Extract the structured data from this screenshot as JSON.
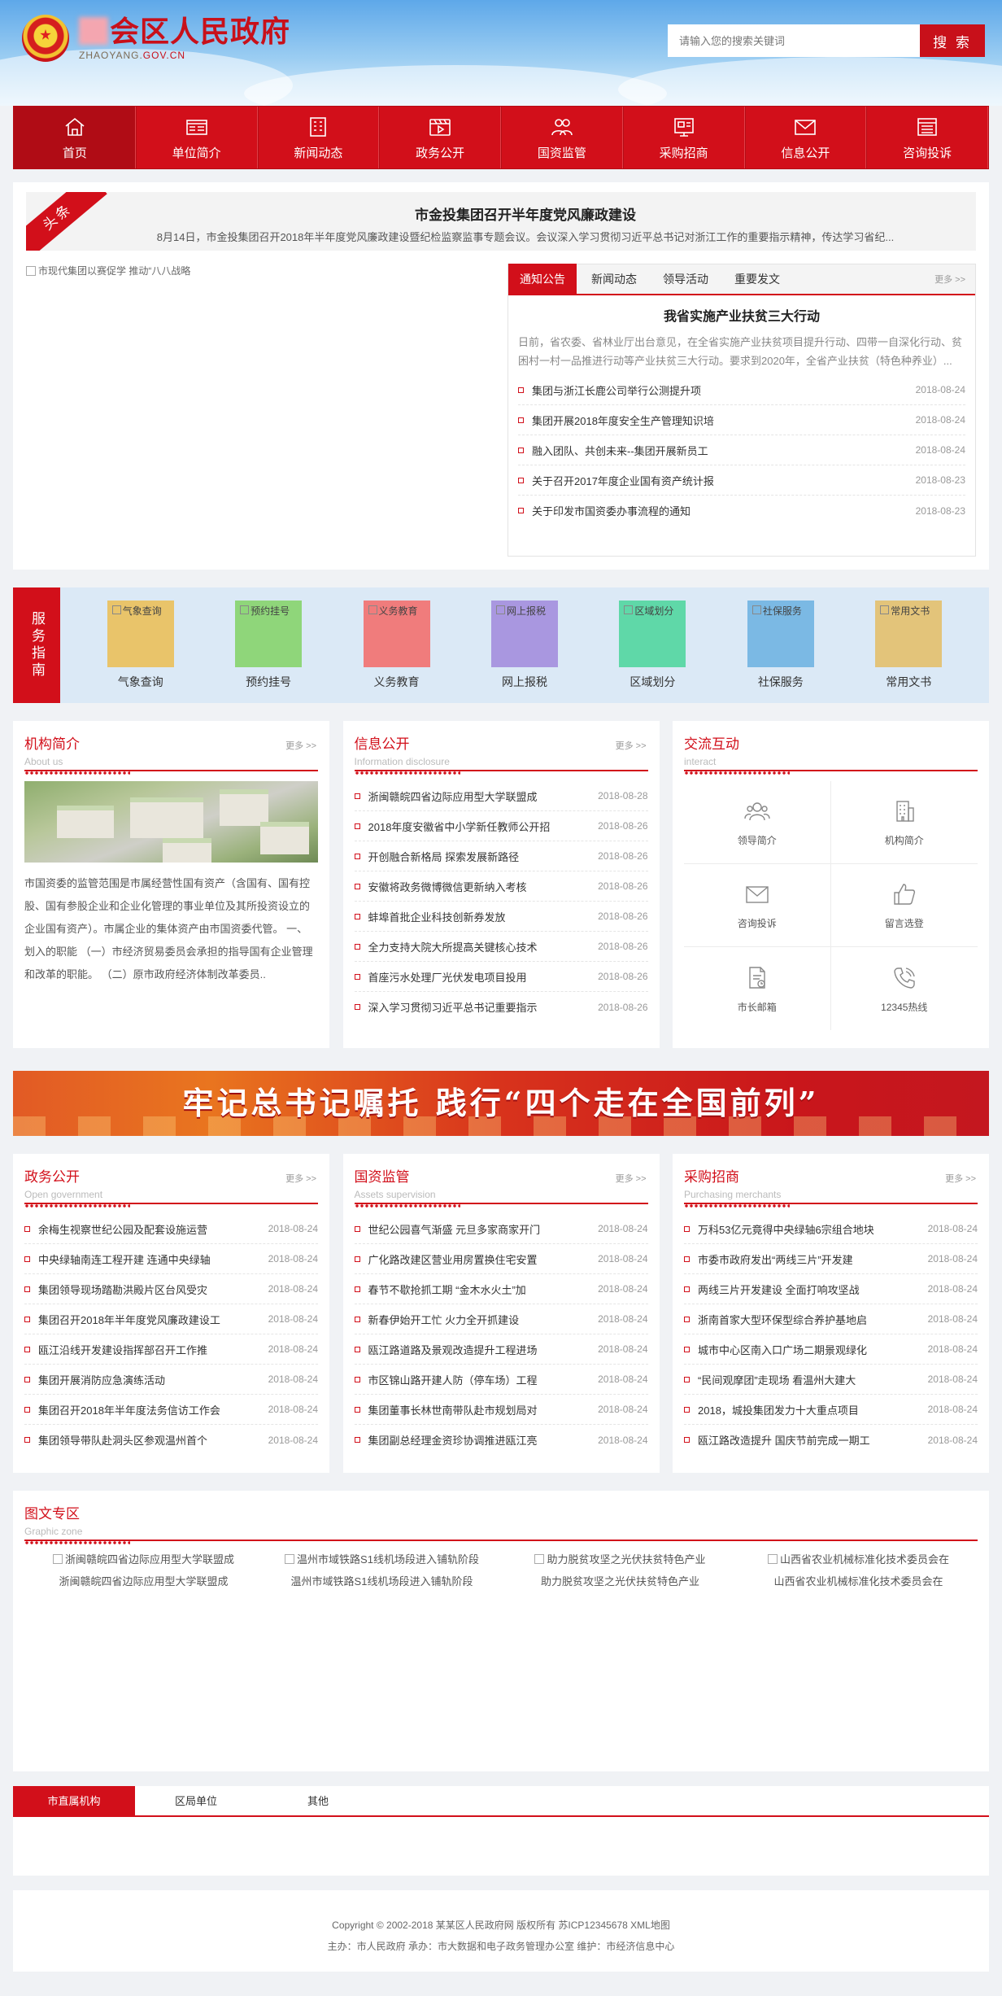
{
  "header": {
    "site_name": "会区人民政府",
    "domain_prefix": "ZHAOYANG.",
    "domain_suffix": "GOV.CN",
    "search_placeholder": "请输入您的搜索关键词",
    "search_button": "搜 索"
  },
  "nav": [
    {
      "label": "首页",
      "icon": "home-icon"
    },
    {
      "label": "单位简介",
      "icon": "news-icon"
    },
    {
      "label": "新闻动态",
      "icon": "building-icon"
    },
    {
      "label": "政务公开",
      "icon": "video-icon"
    },
    {
      "label": "国资监管",
      "icon": "users-icon"
    },
    {
      "label": "采购招商",
      "icon": "board-icon"
    },
    {
      "label": "信息公开",
      "icon": "mail-icon"
    },
    {
      "label": "咨询投诉",
      "icon": "document-icon"
    }
  ],
  "headline": {
    "ribbon": "头条",
    "title": "市金投集团召开半年度党风廉政建设",
    "summary": "8月14日，市金投集团召开2018年半年度党风廉政建设暨纪检监察监事专题会议。会议深入学习贯彻习近平总书记对浙江工作的重要指示精神，传达学习省纪..."
  },
  "slide_alt": "市现代集团以赛促学 推动“八八战略",
  "news_tabs": [
    "通知公告",
    "新闻动态",
    "领导活动",
    "重要发文"
  ],
  "more": "更多 >>",
  "featured": {
    "title": "我省实施产业扶贫三大行动",
    "text": "日前，省农委、省林业厅出台意见，在全省实施产业扶贫项目提升行动、四带一自深化行动、贫困村一村一品推进行动等产业扶贫三大行动。要求到2020年，全省产业扶贫（特色种养业）..."
  },
  "notice_list": [
    {
      "text": "集团与浙江长鹿公司举行公测提升项",
      "date": "2018-08-24"
    },
    {
      "text": "集团开展2018年度安全生产管理知识培",
      "date": "2018-08-24"
    },
    {
      "text": "融入团队、共创未来--集团开展新员工",
      "date": "2018-08-24"
    },
    {
      "text": "关于召开2017年度企业国有资产统计报",
      "date": "2018-08-23"
    },
    {
      "text": "关于印发市国资委办事流程的通知",
      "date": "2018-08-23"
    }
  ],
  "service": {
    "label": "服务指南",
    "items": [
      {
        "label": "气象查询",
        "color": "#e9c46a"
      },
      {
        "label": "预约挂号",
        "color": "#8fd67a"
      },
      {
        "label": "义务教育",
        "color": "#f07c7c"
      },
      {
        "label": "网上报税",
        "color": "#a997e0"
      },
      {
        "label": "区域划分",
        "color": "#5fd8a8"
      },
      {
        "label": "社保服务",
        "color": "#7bb9e4"
      },
      {
        "label": "常用文书",
        "color": "#e3c47a"
      }
    ]
  },
  "about": {
    "cn": "机构简介",
    "en": "About us",
    "text": "市国资委的监管范围是市属经营性国有资产（含国有、国有控股、国有参股企业和企业化管理的事业单位及其所投资设立的企业国有资产）。市属企业的集体资产由市国资委代管。 一、划入的职能 （一）市经济贸易委员会承担的指导国有企业管理和改革的职能。 （二）原市政府经济体制改革委员.."
  },
  "info": {
    "cn": "信息公开",
    "en": "Information disclosure",
    "items": [
      {
        "text": "浙闽赣皖四省边际应用型大学联盟成",
        "date": "2018-08-28"
      },
      {
        "text": "2018年度安徽省中小学新任教师公开招",
        "date": "2018-08-26"
      },
      {
        "text": "开创融合新格局 探索发展新路径",
        "date": "2018-08-26"
      },
      {
        "text": "安徽将政务微博微信更新纳入考核",
        "date": "2018-08-26"
      },
      {
        "text": "蚌埠首批企业科技创新券发放",
        "date": "2018-08-26"
      },
      {
        "text": "全力支持大院大所提高关键核心技术",
        "date": "2018-08-26"
      },
      {
        "text": "首座污水处理厂光伏发电项目投用",
        "date": "2018-08-26"
      },
      {
        "text": "深入学习贯彻习近平总书记重要指示",
        "date": "2018-08-26"
      }
    ]
  },
  "interact": {
    "cn": "交流互动",
    "en": "interact",
    "items": [
      {
        "label": "领导简介",
        "icon": "people-icon"
      },
      {
        "label": "机构简介",
        "icon": "building-icon"
      },
      {
        "label": "咨询投诉",
        "icon": "mail-icon"
      },
      {
        "label": "留言选登",
        "icon": "thumbs-up-icon"
      },
      {
        "label": "市长邮箱",
        "icon": "mailbox-icon"
      },
      {
        "label": "12345热线",
        "icon": "phone-icon"
      }
    ]
  },
  "banner": {
    "slogan": "牢记总书记嘱托 践行“四个走在全国前列”"
  },
  "gov": {
    "cn": "政务公开",
    "en": "Open government",
    "items": [
      {
        "text": "余梅生视察世纪公园及配套设施运营",
        "date": "2018-08-24"
      },
      {
        "text": "中央绿轴南连工程开建 连通中央绿轴",
        "date": "2018-08-24"
      },
      {
        "text": "集团领导现场踏勘洪殿片区台风受灾",
        "date": "2018-08-24"
      },
      {
        "text": "集团召开2018年半年度党风廉政建设工",
        "date": "2018-08-24"
      },
      {
        "text": "瓯江沿线开发建设指挥部召开工作推",
        "date": "2018-08-24"
      },
      {
        "text": "集团开展消防应急演练活动",
        "date": "2018-08-24"
      },
      {
        "text": "集团召开2018年半年度法务信访工作会",
        "date": "2018-08-24"
      },
      {
        "text": "集团领导带队赴洞头区参观温州首个",
        "date": "2018-08-24"
      }
    ]
  },
  "assets": {
    "cn": "国资监管",
    "en": "Assets supervision",
    "items": [
      {
        "text": "世纪公园喜气渐盛 元旦多家商家开门",
        "date": "2018-08-24"
      },
      {
        "text": "广化路改建区营业用房置换住宅安置",
        "date": "2018-08-24"
      },
      {
        "text": "春节不歇抢抓工期 “金木水火土”加",
        "date": "2018-08-24"
      },
      {
        "text": "新春伊始开工忙 火力全开抓建设",
        "date": "2018-08-24"
      },
      {
        "text": "瓯江路道路及景观改造提升工程进场",
        "date": "2018-08-24"
      },
      {
        "text": "市区锦山路开建人防（停车场）工程",
        "date": "2018-08-24"
      },
      {
        "text": "集团董事长林世南带队赴市规划局对",
        "date": "2018-08-24"
      },
      {
        "text": "集团副总经理金资珍协调推进瓯江亮",
        "date": "2018-08-24"
      }
    ]
  },
  "purchase": {
    "cn": "采购招商",
    "en": "Purchasing merchants",
    "items": [
      {
        "text": "万科53亿元竟得中央绿轴6宗组合地块",
        "date": "2018-08-24"
      },
      {
        "text": "市委市政府发出“两线三片”开发建",
        "date": "2018-08-24"
      },
      {
        "text": "两线三片开发建设 全面打响攻坚战",
        "date": "2018-08-24"
      },
      {
        "text": "浙南首家大型环保型综合养护基地启",
        "date": "2018-08-24"
      },
      {
        "text": "城市中心区南入口广场二期景观绿化",
        "date": "2018-08-24"
      },
      {
        "text": "“民间观摩团”走现场 看温州大建大",
        "date": "2018-08-24"
      },
      {
        "text": "2018，城投集团发力十大重点项目",
        "date": "2018-08-24"
      },
      {
        "text": "瓯江路改造提升 国庆节前完成一期工",
        "date": "2018-08-24"
      }
    ]
  },
  "gallery": {
    "cn": "图文专区",
    "en": "Graphic zone",
    "items": [
      {
        "alt": "浙闽赣皖四省边际应用型大学联盟成",
        "caption": "浙闽赣皖四省边际应用型大学联盟成"
      },
      {
        "alt": "温州市域铁路S1线机场段进入铺轨阶段",
        "caption": "温州市域铁路S1线机场段进入铺轨阶段"
      },
      {
        "alt": "助力脱贫攻坚之光伏扶贫特色产业",
        "caption": "助力脱贫攻坚之光伏扶贫特色产业"
      },
      {
        "alt": "山西省农业机械标准化技术委员会在",
        "caption": "山西省农业机械标准化技术委员会在"
      }
    ]
  },
  "links_tabs": [
    "市直属机构",
    "区局单位",
    "其他"
  ],
  "footer": {
    "line1": "Copyright © 2002-2018 某某区人民政府网 版权所有 苏ICP12345678 XML地图",
    "line2": "主办：市人民政府 承办：市大数据和电子政务管理办公室 维护：市经济信息中心"
  }
}
